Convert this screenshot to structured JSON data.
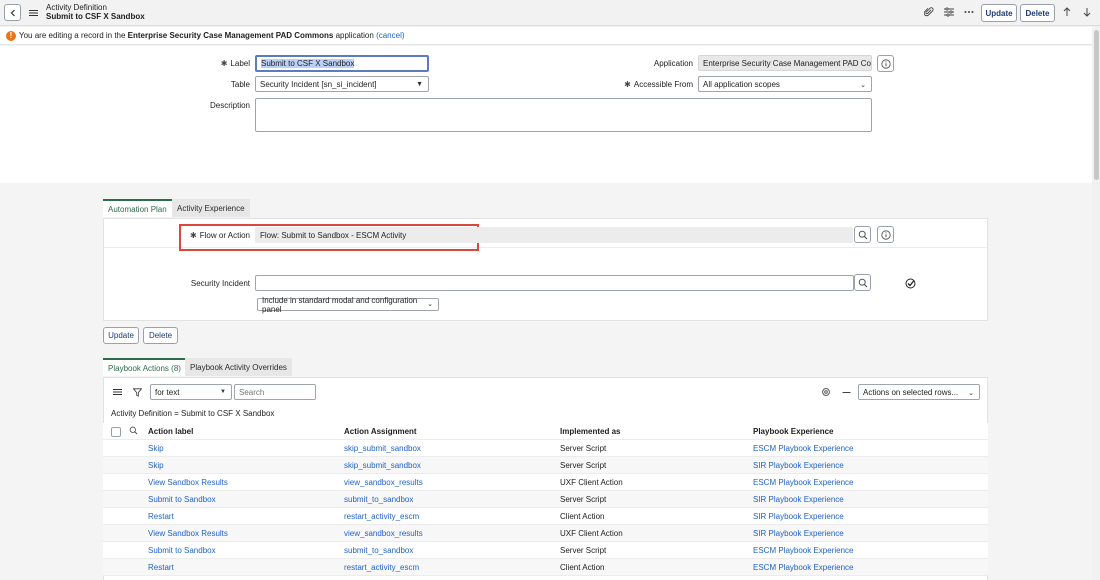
{
  "header": {
    "title_line1": "Activity Definition",
    "title_line2": "Submit to CSF X Sandbox",
    "update_label": "Update",
    "delete_label": "Delete"
  },
  "banner": {
    "prefix": "You are editing a record in the ",
    "app_name": "Enterprise Security Case Management PAD Commons",
    "suffix": " application ",
    "cancel": "(cancel)"
  },
  "form": {
    "label_label": "Label",
    "label_value": "Submit to CSF X Sandbox",
    "table_label": "Table",
    "table_value": "Security Incident [sn_si_incident]",
    "description_label": "Description",
    "application_label": "Application",
    "application_value": "Enterprise Security Case Management PAD Comr",
    "accessible_label": "Accessible From",
    "accessible_value": "All application scopes"
  },
  "tabs": {
    "automation_plan": "Automation Plan",
    "activity_experience": "Activity Experience"
  },
  "automation": {
    "flow_label": "Flow or Action",
    "flow_value": "Flow: Submit to Sandbox - ESCM Activity",
    "security_incident_label": "Security Incident",
    "security_incident_value": "",
    "include_option": "Include in standard modal and configuration panel"
  },
  "actions": {
    "update_label": "Update",
    "delete_label": "Delete"
  },
  "related_tabs": {
    "playbook_actions": "Playbook Actions (8)",
    "playbook_overrides": "Playbook Activity Overrides"
  },
  "list": {
    "search_field_option": "for text",
    "search_placeholder": "Search",
    "actions_select": "Actions on selected rows...",
    "breadcrumb": "Activity Definition = Submit to CSF X Sandbox",
    "columns": [
      "Action label",
      "Action Assignment",
      "Implemented as",
      "Playbook Experience"
    ],
    "rows": [
      {
        "label": "Skip",
        "assignment": "skip_submit_sandbox",
        "implemented": "Server Script",
        "experience": "ESCM Playbook Experience"
      },
      {
        "label": "Skip",
        "assignment": "skip_submit_sandbox",
        "implemented": "Server Script",
        "experience": "SIR Playbook Experience"
      },
      {
        "label": "View Sandbox Results",
        "assignment": "view_sandbox_results",
        "implemented": "UXF Client Action",
        "experience": "ESCM Playbook Experience"
      },
      {
        "label": "Submit to Sandbox",
        "assignment": "submit_to_sandbox",
        "implemented": "Server Script",
        "experience": "SIR Playbook Experience"
      },
      {
        "label": "Restart",
        "assignment": "restart_activity_escm",
        "implemented": "Client Action",
        "experience": "SIR Playbook Experience"
      },
      {
        "label": "View Sandbox Results",
        "assignment": "view_sandbox_results",
        "implemented": "UXF Client Action",
        "experience": "SIR Playbook Experience"
      },
      {
        "label": "Submit to Sandbox",
        "assignment": "submit_to_sandbox",
        "implemented": "Server Script",
        "experience": "ESCM Playbook Experience"
      },
      {
        "label": "Restart",
        "assignment": "restart_activity_escm",
        "implemented": "Client Action",
        "experience": "ESCM Playbook Experience"
      }
    ]
  },
  "colors": {
    "link": "#1f62c9",
    "accent_green": "#2d6b4a",
    "highlight_red": "#d9493a",
    "warning_orange": "#e8751a"
  }
}
